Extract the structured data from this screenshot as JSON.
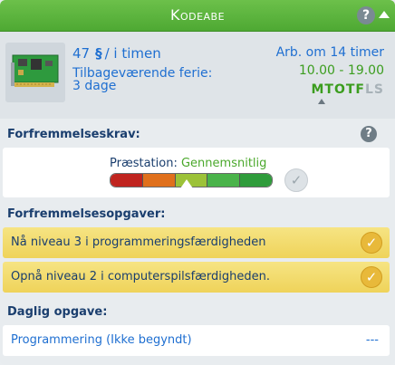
{
  "header": {
    "title": "Kodeabe"
  },
  "job": {
    "pay_amount": "47",
    "pay_currency_symbol": "§",
    "pay_unit": "/ i timen",
    "vacation_label": "Tilbageværende ferie:",
    "vacation_value": "3 dage",
    "next_work": "Arb. om 14 timer",
    "hours": "10.00 - 19.00",
    "days": [
      {
        "letter": "M",
        "work": true
      },
      {
        "letter": "T",
        "work": true
      },
      {
        "letter": "O",
        "work": true
      },
      {
        "letter": "T",
        "work": true
      },
      {
        "letter": "F",
        "work": true
      },
      {
        "letter": "L",
        "work": false
      },
      {
        "letter": "S",
        "work": false
      }
    ]
  },
  "promotion": {
    "heading": "Forfremmelseskrav:",
    "performance_label": "Præstation:",
    "performance_value": "Gennemsnitlig",
    "performance_fraction": 0.48
  },
  "tasks": {
    "heading": "Forfremmelsesopgaver:",
    "items": [
      {
        "label": "Nå niveau 3 i programmeringsfærdigheden",
        "done": true
      },
      {
        "label": "Opnå niveau 2 i computerspilsfærdigheden.",
        "done": true
      }
    ]
  },
  "daily": {
    "heading": "Daglig opgave:",
    "label": "Programmering (Ikke begyndt)",
    "progress": "---"
  },
  "colors": {
    "header_green": "#4ea933",
    "accent_blue": "#1f6fd1",
    "work_green": "#3b9d1e",
    "task_yellow": "#efd35a"
  }
}
